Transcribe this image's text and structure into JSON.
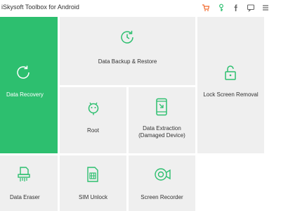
{
  "app": {
    "title": "iSkysoft Toolbox for Android"
  },
  "toolbar": {
    "icons": [
      {
        "name": "cart-icon",
        "color": "#f26a2e"
      },
      {
        "name": "key-icon",
        "color": "#2dbf6f"
      },
      {
        "name": "facebook-icon",
        "color": "#666666"
      },
      {
        "name": "feedback-icon",
        "color": "#666666"
      },
      {
        "name": "menu-icon",
        "color": "#666666"
      }
    ]
  },
  "colors": {
    "accent": "#2dbf6f",
    "tile_bg": "#efefef",
    "icon": "#2dbf6f"
  },
  "tiles": [
    {
      "id": "data-recovery",
      "label": "Data Recovery",
      "icon": "refresh-icon",
      "active": true
    },
    {
      "id": "data-backup-restore",
      "label": "Data Backup & Restore",
      "icon": "clock-sync-icon",
      "active": false
    },
    {
      "id": "lock-screen-removal",
      "label": "Lock Screen Removal",
      "icon": "padlock-icon",
      "active": false
    },
    {
      "id": "root",
      "label": "Root",
      "icon": "android-icon",
      "active": false
    },
    {
      "id": "data-extraction",
      "label": "Data Extraction (Damaged Device)",
      "icon": "phone-extract-icon",
      "active": false
    },
    {
      "id": "data-eraser",
      "label": "Data Eraser",
      "icon": "shredder-icon",
      "active": false
    },
    {
      "id": "sim-unlock",
      "label": "SIM Unlock",
      "icon": "sim-card-icon",
      "active": false
    },
    {
      "id": "screen-recorder",
      "label": "Screen Recorder",
      "icon": "camera-record-icon",
      "active": false
    }
  ]
}
